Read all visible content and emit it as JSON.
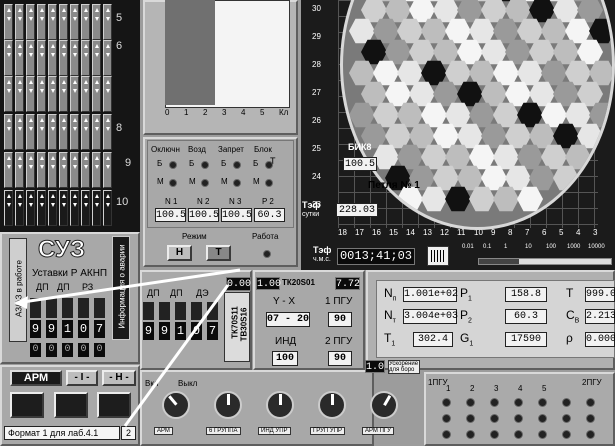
{
  "suz": {
    "title": "СУЗ",
    "subtitle": "Уставки Р АКНП",
    "vertical_left": "АЗ/АЗ в работе",
    "vertical_right": "Информация о аварии",
    "col_labels": [
      "ДП",
      "ДП",
      "РЗ"
    ],
    "col_labels2": [
      "ДП",
      "ДП",
      "ДЭ"
    ],
    "digits_a": [
      "9",
      "9",
      "1",
      "0",
      "7"
    ],
    "digits_b": [
      "0",
      "0",
      "0",
      "0",
      "0"
    ],
    "digits_c": [
      "9",
      "9",
      "1",
      "0",
      "7"
    ],
    "rows": [
      "5",
      "6",
      "8",
      "9",
      "10"
    ]
  },
  "reactor": {
    "bik": {
      "label": "БИК8",
      "value": "100.5"
    },
    "loop": {
      "label": "Петля № 1"
    },
    "tef": {
      "label": "Тэф",
      "sub": "сутки",
      "value": "228.03"
    },
    "tef2": {
      "label": "Тэф",
      "sub": "ч.м.с.",
      "value": "0013;41;03"
    },
    "xticks": [
      "18",
      "17",
      "16",
      "15",
      "14",
      "13",
      "12",
      "11",
      "10",
      "9",
      "8",
      "7",
      "6",
      "5",
      "4",
      "3"
    ],
    "yticks": [
      "30",
      "29",
      "28",
      "27",
      "26",
      "25",
      "24",
      "23"
    ],
    "scale_ticks": [
      "0.01",
      "0.1",
      "1",
      "10",
      "100",
      "1000",
      "10000"
    ]
  },
  "modes": {
    "headers": [
      "Оключн",
      "Возд",
      "Запрет",
      "Блок"
    ],
    "T_label": "Т",
    "B_label": "Б",
    "M_label": "М",
    "n_labels": [
      "N 1",
      "N 2",
      "N 3",
      "P 2"
    ],
    "n_values": [
      "100.5",
      "100.5",
      "100.5",
      "60.3"
    ],
    "mode_label": "Режим",
    "work_label": "Работа",
    "btn_h": "Н",
    "btn_t": "Т"
  },
  "bar_axis": [
    "0",
    "1",
    "2",
    "3",
    "4",
    "5",
    "Кл"
  ],
  "tk": {
    "tk_code": "ТК20S01",
    "tk_left": "1.00",
    "tk_right": "7.72",
    "small_lcd": "0.00",
    "tb_vertical": "ТВ30S16",
    "tk_vertical": "ТК70S11",
    "yx_label": "Y - X",
    "yx_value": "07 - 20",
    "pgu1_label": "1 ПГУ",
    "pgu1_value": "90",
    "ind_label": "ИНД",
    "ind_value": "100",
    "pgu2_label": "2 ПГУ",
    "pgu2_value": "90",
    "bottom_left": "1.0",
    "bottom_note": "Ускорение для боро"
  },
  "params": {
    "N1_label": "N",
    "N1_sub": "п",
    "N1_value": "1.001e+02",
    "N2_label": "N",
    "N2_sub": "т",
    "N2_value": "3.004e+03",
    "T1_label": "Т",
    "T1_sub": "1",
    "T1_value": "302.4",
    "P1_label": "Р",
    "P1_sub": "1",
    "P1_value": "158.8",
    "P2_label": "Р",
    "P2_sub": "2",
    "P2_value": "60.3",
    "G1_label": "G",
    "G1_sub": "1",
    "G1_value": "17590",
    "T_label": "T",
    "T_value": "999.0",
    "CB_label": "C",
    "CB_sub": "В",
    "CB_value": "2.213",
    "rho_label": "ρ",
    "rho_value": "0.000"
  },
  "arm": {
    "title": "АРМ",
    "btn1": "- I -",
    "btn2": "- Н -",
    "format_label": "Формат 1  для лаб.4.1",
    "format_num": "2",
    "vykl1": "Вкл",
    "vykl2": "Выкл",
    "switches": [
      "АРМ",
      "6 ГРУППА",
      "ИНД УПР",
      "ГРУП УПР",
      "АРМ ПГУ"
    ]
  },
  "pgu_panel": {
    "label1": "1ПГУ",
    "label2": "2ПГУ",
    "nums": [
      "1",
      "2",
      "3",
      "4",
      "5"
    ]
  }
}
